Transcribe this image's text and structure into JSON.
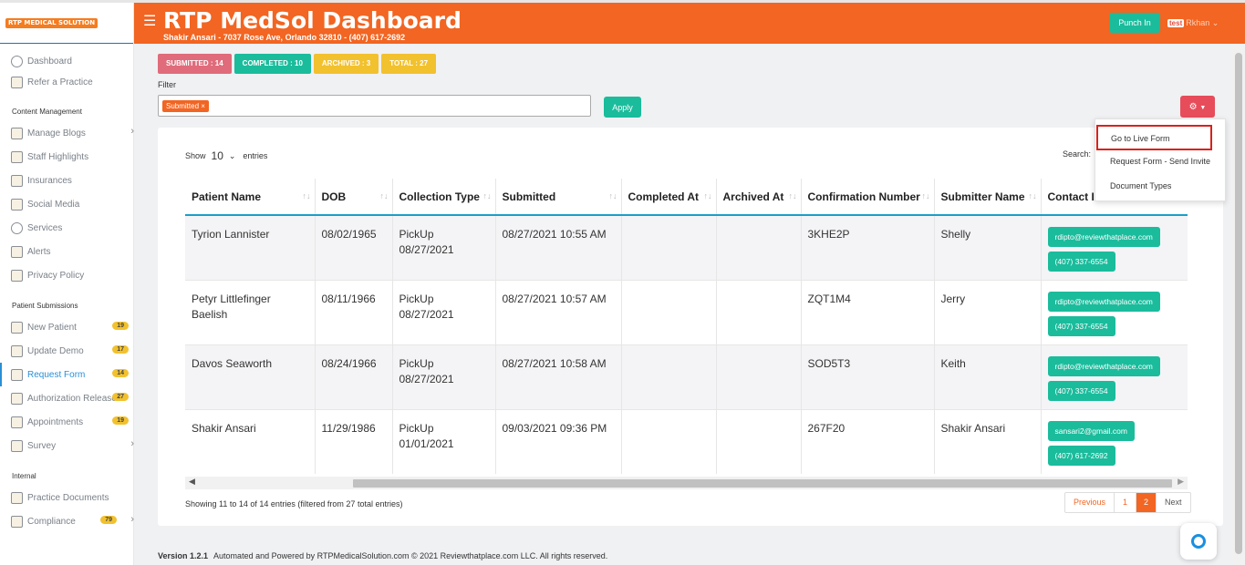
{
  "app": {
    "logo_text": "RTP MEDICAL SOLUTION",
    "title": "RTP MedSol Dashboard",
    "address": "Shakir Ansari - 7037 Rose Ave, Orlando 32810 - (407) 617-2692",
    "punch_label": "Punch In",
    "user_tag": "test",
    "user_name": "Rkhan"
  },
  "sidebar": {
    "top": [
      {
        "label": "Dashboard",
        "icon": "dashboard-icon"
      },
      {
        "label": "Refer a Practice",
        "icon": "refer-icon"
      }
    ],
    "content_heading": "Content Management",
    "content": [
      {
        "label": "Manage Blogs",
        "icon": "blog-icon"
      },
      {
        "label": "Staff Highlights",
        "icon": "staff-icon"
      },
      {
        "label": "Insurances",
        "icon": "insurance-icon"
      },
      {
        "label": "Social Media",
        "icon": "social-icon"
      },
      {
        "label": "Services",
        "icon": "services-icon"
      },
      {
        "label": "Alerts",
        "icon": "alerts-icon"
      },
      {
        "label": "Privacy Policy",
        "icon": "privacy-icon"
      }
    ],
    "patient_heading": "Patient Submissions",
    "patient": [
      {
        "label": "New Patient",
        "badge": "19"
      },
      {
        "label": "Update Demo",
        "badge": "17"
      },
      {
        "label": "Request Form",
        "badge": "14"
      },
      {
        "label": "Authorization Release",
        "badge": "27"
      },
      {
        "label": "Appointments",
        "badge": "19"
      },
      {
        "label": "Survey",
        "badge": ""
      }
    ],
    "internal_heading": "Internal",
    "internal": [
      {
        "label": "Practice Documents",
        "badge": ""
      },
      {
        "label": "Compliance",
        "badge": "79"
      }
    ]
  },
  "status_tags": {
    "submitted": "SUBMITTED : 14",
    "completed": "COMPLETED : 10",
    "archived": "ARCHIVED : 3",
    "total": "TOTAL : 27"
  },
  "filter": {
    "label": "Filter",
    "chip": "Submitted ×",
    "apply": "Apply"
  },
  "dropdown": [
    "Go to Live Form",
    "Request Form - Send Invite",
    "Document Types"
  ],
  "table_controls": {
    "show": "Show",
    "length": "10",
    "entries": "entries",
    "search": "Search:"
  },
  "table": {
    "headers": [
      "Patient Name",
      "DOB",
      "Collection Type",
      "Submitted",
      "Completed At",
      "Archived At",
      "Confirmation Number",
      "Submitter Name",
      "Contact I"
    ],
    "rows": [
      {
        "name": "Tyrion Lannister",
        "dob": "08/02/1965",
        "type": "PickUp",
        "type_date": "08/27/2021",
        "submitted": "08/27/2021 10:55 AM",
        "completed": "",
        "archived": "",
        "conf": "3KHE2P",
        "submitter": "Shelly",
        "email": "rdipto@reviewthatplace.com",
        "phone": "(407) 337-6554"
      },
      {
        "name": "Petyr Littlefinger Baelish",
        "dob": "08/11/1966",
        "type": "PickUp",
        "type_date": "08/27/2021",
        "submitted": "08/27/2021 10:57 AM",
        "completed": "",
        "archived": "",
        "conf": "ZQT1M4",
        "submitter": "Jerry",
        "email": "rdipto@reviewthatplace.com",
        "phone": "(407) 337-6554"
      },
      {
        "name": "Davos Seaworth",
        "dob": "08/24/1966",
        "type": "PickUp",
        "type_date": "08/27/2021",
        "submitted": "08/27/2021 10:58 AM",
        "completed": "",
        "archived": "",
        "conf": "SOD5T3",
        "submitter": "Keith",
        "email": "rdipto@reviewthatplace.com",
        "phone": "(407) 337-6554"
      },
      {
        "name": "Shakir Ansari",
        "dob": "11/29/1986",
        "type": "PickUp",
        "type_date": "01/01/2021",
        "submitted": "09/03/2021 09:36 PM",
        "completed": "",
        "archived": "",
        "conf": "267F20",
        "submitter": "Shakir Ansari",
        "email": "sansari2@gmail.com",
        "phone": "(407) 617-2692"
      }
    ]
  },
  "info": "Showing 11 to 14 of 14 entries (filtered from 27 total entries)",
  "pager": {
    "prev": "Previous",
    "p1": "1",
    "p2": "2",
    "next": "Next"
  },
  "footer": {
    "version": "Version 1.2.1",
    "text": "Automated and Powered by RTPMedicalSolution.com © 2021 Reviewthatplace.com LLC. All rights reserved."
  },
  "colors": {
    "brand": "#f26522",
    "teal": "#1abc9c",
    "red": "#e74c5b",
    "yellow": "#f2c12e"
  }
}
